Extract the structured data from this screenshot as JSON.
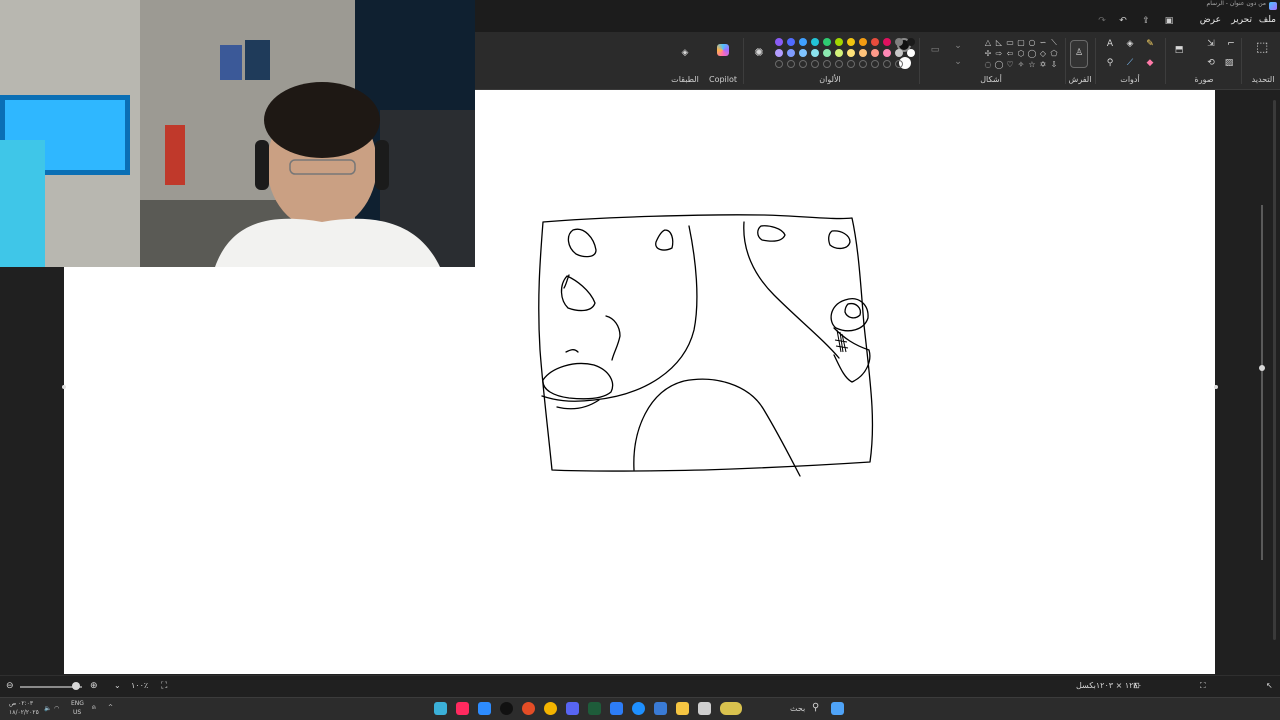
{
  "window": {
    "title": "من دون عنوان - الرسام"
  },
  "menu": {
    "file": "ملف",
    "edit": "تحرير",
    "view": "عرض"
  },
  "ribbon": {
    "groups": {
      "selection": "التحديد",
      "image": "صورة",
      "tools": "أدوات",
      "brushes": "الفرش",
      "shapes": "أشكال",
      "colors": "الألوان",
      "copilot": "Copilot",
      "layers": "الطبقات"
    },
    "palette": {
      "row1": [
        "#8a5cf6",
        "#4f6bff",
        "#3fa0ff",
        "#22c3d6",
        "#2ecc71",
        "#a3d600",
        "#f1c40f",
        "#f39c12",
        "#e74c3c",
        "#e0115f",
        "#7f7f7f",
        "#1a1a1a"
      ],
      "row2": [
        "#b39dff",
        "#7f9cff",
        "#7fc3ff",
        "#8be3ee",
        "#8ce9b0",
        "#d4f27a",
        "#ffe27a",
        "#ffc27a",
        "#ff9a8a",
        "#ff88b5",
        "#c8c8c8",
        "#ffffff"
      ],
      "primary": "#000000",
      "secondary": "#ffffff"
    }
  },
  "status": {
    "zoom": "١٠٠٪",
    "canvas_size": "١٢٨٠ × ١٢٠٣بكسل"
  },
  "taskbar": {
    "search_placeholder": "بحث",
    "language": "ENG",
    "region": "US",
    "time": "٠٢:٠٣ ص",
    "date": "١٨/٠٢/٢٠٢٥"
  },
  "drawing": {
    "stroke_color": "#000000",
    "background": "#ffffff"
  }
}
